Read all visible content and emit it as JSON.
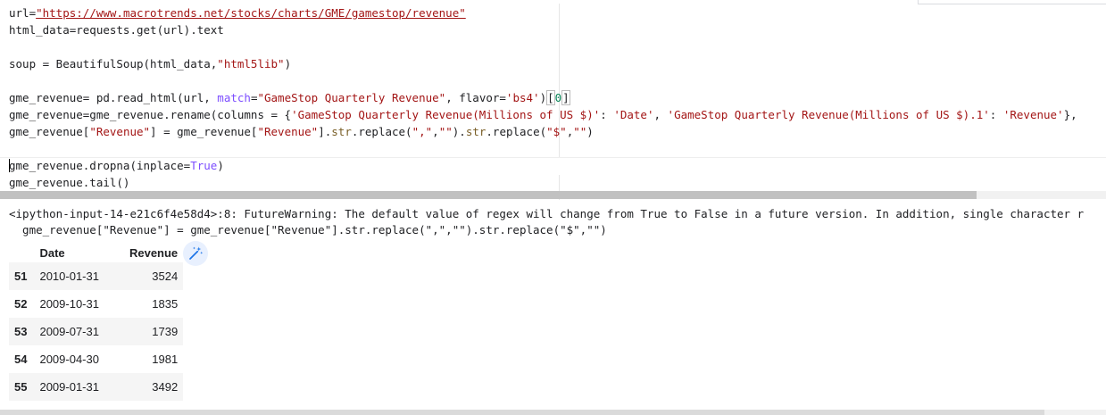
{
  "code": {
    "line1": {
      "prefix": "url=",
      "url": "\"https://www.macrotrends.net/stocks/charts/GME/gamestop/revenue\""
    },
    "line2": "html_data=requests.get(url).text",
    "line3": {
      "a": "soup = BeautifulSoup(html_data,",
      "b": "\"html5lib\"",
      "c": ")"
    },
    "line4": {
      "a": "gme_revenue= pd.read_html(url, ",
      "kw": "match",
      "b": "=",
      "s1": "\"GameStop Quarterly Revenue\"",
      "c": ", flavor=",
      "s2": "'bs4'",
      "d": ")",
      "e": "[",
      "n": "0",
      "f": "]"
    },
    "line5": {
      "a": "gme_revenue=gme_revenue.rename(columns = {",
      "s1": "'GameStop Quarterly Revenue(Millions of US $)'",
      "b": ": ",
      "s2": "'Date'",
      "c": ", ",
      "s3": "'GameStop Quarterly Revenue(Millions of US $).1'",
      "d": ": ",
      "s4": "'Revenue'",
      "e": "},"
    },
    "line6": {
      "a": "gme_revenue[",
      "s1": "\"Revenue\"",
      "b": "] = gme_revenue[",
      "s2": "\"Revenue\"",
      "c": "].",
      "fn1": "str",
      "d": ".replace(",
      "s3": "\",\"",
      "e": ",",
      "s4": "\"\"",
      "f": ").",
      "fn2": "str",
      "g": ".replace(",
      "s5": "\"$\"",
      "h": ",",
      "s6": "\"\"",
      "i": ")"
    },
    "line7": {
      "a": "gme_revenue.dropna(inplace=",
      "kw": "True",
      "b": ")"
    },
    "line8": "gme_revenue.tail()"
  },
  "warning": {
    "line1": "<ipython-input-14-e21c6f4e58d4>:8: FutureWarning: The default value of regex will change from True to False in a future version. In addition, single character r",
    "line2": "  gme_revenue[\"Revenue\"] = gme_revenue[\"Revenue\"].str.replace(\",\",\"\").str.replace(\"$\",\"\")"
  },
  "table": {
    "columns": [
      "Date",
      "Revenue"
    ],
    "rows": [
      {
        "index": "51",
        "date": "2010-01-31",
        "revenue": "3524"
      },
      {
        "index": "52",
        "date": "2009-10-31",
        "revenue": "1835"
      },
      {
        "index": "53",
        "date": "2009-07-31",
        "revenue": "1739"
      },
      {
        "index": "54",
        "date": "2009-04-30",
        "revenue": "1981"
      },
      {
        "index": "55",
        "date": "2009-01-31",
        "revenue": "3492"
      }
    ]
  },
  "icons": {
    "wand": "magic-wand-icon"
  },
  "colors": {
    "string": "#a31515",
    "keyword": "#7c4dff",
    "number": "#098658",
    "wand_bg": "#e8f0fe"
  }
}
